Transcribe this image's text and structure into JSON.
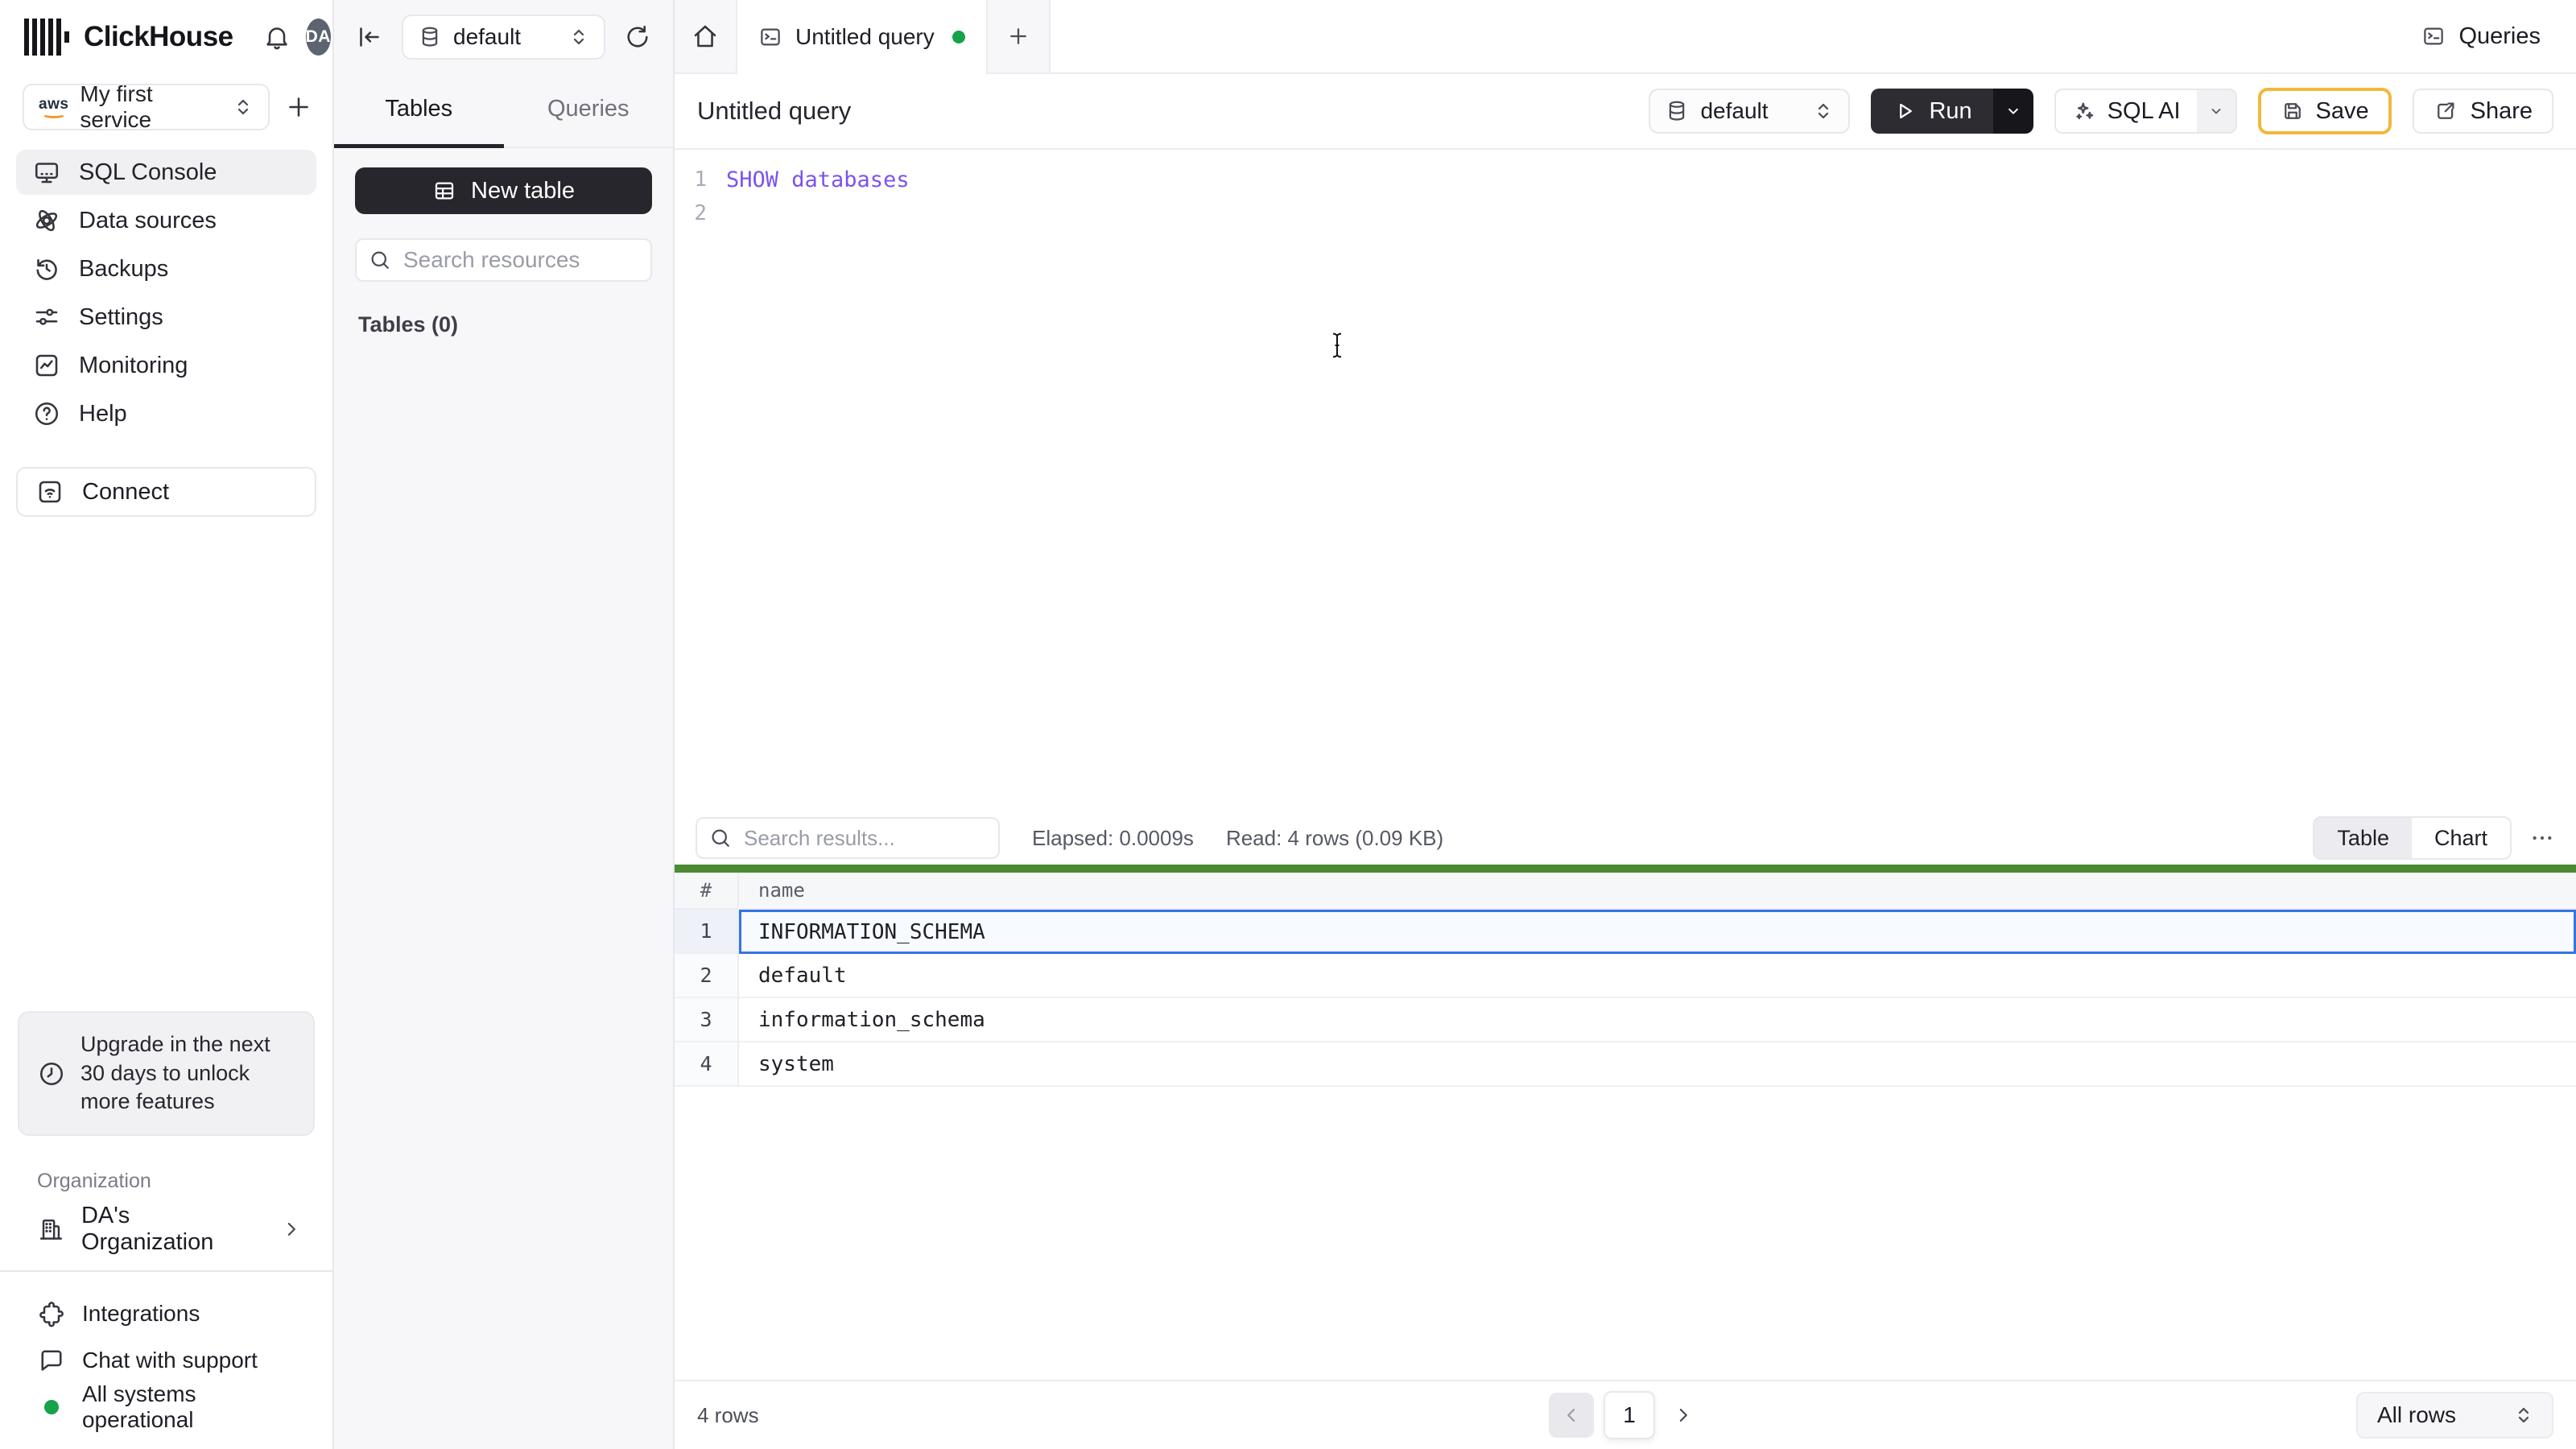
{
  "app": {
    "brand": "ClickHouse",
    "avatar_initials": "DA"
  },
  "colors": {
    "code_purple": "#7b52f0",
    "selection_blue": "#3574e3",
    "accent_green": "#4a8b33",
    "status_green": "#16a34a",
    "save_border": "#f3b73b"
  },
  "sidebar": {
    "service_selector": {
      "label": "My first service",
      "provider_icon": "aws-logo"
    },
    "nav": [
      {
        "label": "SQL Console",
        "icon": "sql-console-icon",
        "active": true
      },
      {
        "label": "Data sources",
        "icon": "data-sources-icon",
        "active": false
      },
      {
        "label": "Backups",
        "icon": "backups-icon",
        "active": false
      },
      {
        "label": "Settings",
        "icon": "settings-icon",
        "active": false
      },
      {
        "label": "Monitoring",
        "icon": "monitoring-icon",
        "active": false
      },
      {
        "label": "Help",
        "icon": "help-icon",
        "active": false
      }
    ],
    "connect_label": "Connect",
    "upgrade_notice": "Upgrade in the next 30 days to unlock more features",
    "organization": {
      "section_label": "Organization",
      "name": "DA's Organization"
    },
    "footer": {
      "integrations": "Integrations",
      "chat": "Chat with support",
      "status": "All systems operational"
    }
  },
  "explorer": {
    "database_selector": "default",
    "tabs": {
      "tables": "Tables",
      "queries": "Queries"
    },
    "new_table_label": "New table",
    "search_placeholder": "Search resources",
    "section_label": "Tables (0)"
  },
  "tabstrip": {
    "active_tab": "Untitled query",
    "queries_button": "Queries"
  },
  "query": {
    "title": "Untitled query",
    "database_selector": "default",
    "run_label": "Run",
    "sql_ai_label": "SQL AI",
    "save_label": "Save",
    "share_label": "Share",
    "editor_lines": [
      {
        "number": "1",
        "code": "SHOW databases"
      },
      {
        "number": "2",
        "code": ""
      }
    ]
  },
  "results": {
    "search_placeholder": "Search results...",
    "elapsed": "Elapsed: 0.0009s",
    "read": "Read: 4 rows (0.09 KB)",
    "view_toggle": {
      "table": "Table",
      "chart": "Chart"
    },
    "table": {
      "index_header": "#",
      "name_header": "name",
      "rows": [
        "INFORMATION_SCHEMA",
        "default",
        "information_schema",
        "system"
      ],
      "selected_row_index": 0
    },
    "footer": {
      "row_count": "4 rows",
      "current_page": "1",
      "page_size": "All rows"
    }
  }
}
